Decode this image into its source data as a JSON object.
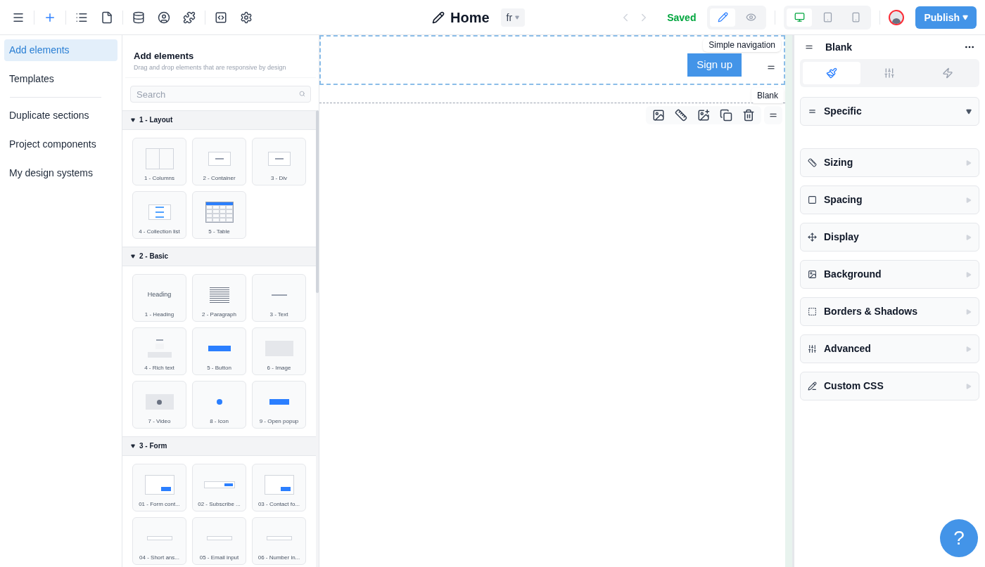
{
  "toolbar": {
    "page_title": "Home",
    "language": "fr",
    "save_status": "Saved",
    "modes": [
      {
        "kind": "edit",
        "selected": true
      },
      {
        "kind": "preview",
        "selected": false
      }
    ],
    "devices": [
      {
        "kind": "desktop",
        "selected": true
      },
      {
        "kind": "tablet",
        "selected": false
      },
      {
        "kind": "mobile",
        "selected": false
      }
    ],
    "publish": "Publish"
  },
  "sidebar": {
    "items": [
      {
        "label": "Add elements",
        "selected": true
      },
      {
        "label": "Templates",
        "selected": false
      },
      {
        "label": "Duplicate sections",
        "selected": false
      },
      {
        "label": "Project components",
        "selected": false
      },
      {
        "label": "My design systems",
        "selected": false
      }
    ]
  },
  "elements_panel": {
    "title": "Add elements",
    "subtitle": "Drag and drop elements that are responsive by design",
    "search": {
      "placeholder": "Search"
    },
    "groups": [
      {
        "title": "1 - Layout",
        "expanded": true,
        "items": [
          {
            "label": "1 - Columns",
            "kind": "columns"
          },
          {
            "label": "2 - Container",
            "kind": "container"
          },
          {
            "label": "3 - Div",
            "kind": "div"
          },
          {
            "label": "4 - Collection list",
            "kind": "list"
          },
          {
            "label": "5 - Table",
            "kind": "table"
          }
        ]
      },
      {
        "title": "2 - Basic",
        "expanded": true,
        "items": [
          {
            "label": "1 - Heading",
            "kind": "heading",
            "preview": "Heading"
          },
          {
            "label": "2 - Paragraph",
            "kind": "paragraph"
          },
          {
            "label": "3 - Text",
            "kind": "text"
          },
          {
            "label": "4 - Rich text",
            "kind": "richtext"
          },
          {
            "label": "5 - Button",
            "kind": "button"
          },
          {
            "label": "6 - Image",
            "kind": "image"
          },
          {
            "label": "7 - Video",
            "kind": "video"
          },
          {
            "label": "8 - Icon",
            "kind": "icon"
          },
          {
            "label": "9 - Open popup",
            "kind": "popup"
          }
        ]
      },
      {
        "title": "3 - Form",
        "expanded": true,
        "items": [
          {
            "label": "01 - Form cont...",
            "kind": "form"
          },
          {
            "label": "02 - Subscribe ...",
            "kind": "subscribe"
          },
          {
            "label": "03 - Contact fo...",
            "kind": "contact"
          },
          {
            "label": "04 - Short ans...",
            "kind": "input"
          },
          {
            "label": "05 - Email input",
            "kind": "input"
          },
          {
            "label": "06 - Number in...",
            "kind": "input"
          }
        ]
      }
    ]
  },
  "canvas": {
    "nav_section": {
      "label": "Simple navigation",
      "button": "Sign up"
    },
    "blank_section": {
      "label": "Blank"
    }
  },
  "inspector": {
    "title": "Blank",
    "tabs": [
      {
        "kind": "style",
        "selected": true
      },
      {
        "kind": "settings",
        "selected": false
      },
      {
        "kind": "interactions",
        "selected": false
      }
    ],
    "sections": [
      {
        "label": "Specific",
        "kind": "specific",
        "expanded": true
      },
      {
        "label": "Sizing",
        "kind": "sizing",
        "expanded": false
      },
      {
        "label": "Spacing",
        "kind": "spacing",
        "expanded": false
      },
      {
        "label": "Display",
        "kind": "display",
        "expanded": false
      },
      {
        "label": "Background",
        "kind": "background",
        "expanded": false
      },
      {
        "label": "Borders & Shadows",
        "kind": "borders",
        "expanded": false
      },
      {
        "label": "Advanced",
        "kind": "advanced",
        "expanded": false
      },
      {
        "label": "Custom CSS",
        "kind": "css",
        "expanded": false
      }
    ]
  },
  "help": "?"
}
